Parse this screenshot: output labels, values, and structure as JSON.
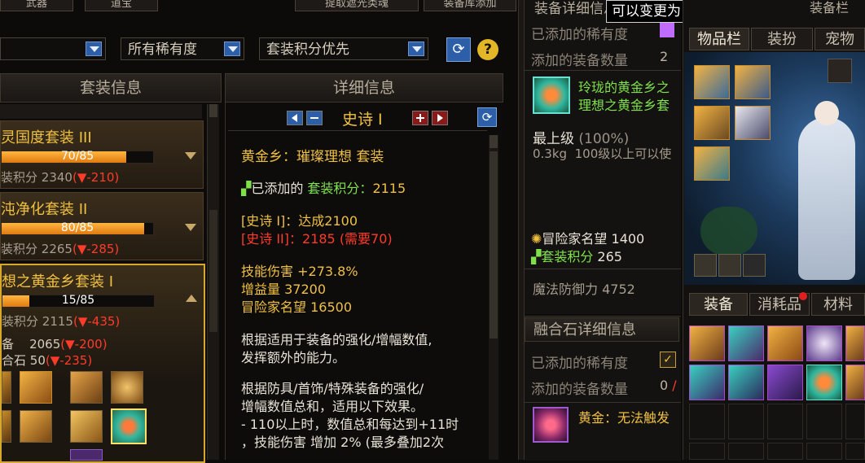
{
  "top_tabs": [
    "武器",
    "道宝",
    "提取遮光类魂",
    "装备库添加"
  ],
  "filters": {
    "rarity": "所有稀有度",
    "sort": "套装积分优先"
  },
  "left_header": "套装信息",
  "left_sets": [
    {
      "name": "灵国度套装 III",
      "progress": "70/85",
      "fill": 0.82,
      "points_label": "装积分",
      "points": "2340",
      "delta": "(▼-210)"
    },
    {
      "name": "沌净化套装 II",
      "progress": "80/85",
      "fill": 0.94,
      "points_label": "装积分",
      "points": "2265",
      "delta": "(▼-285)"
    },
    {
      "name": "想之黄金乡套装 I",
      "progress": "15/85",
      "fill": 0.18,
      "points_label": "装积分",
      "points": "2115",
      "delta": "(▼-435)"
    }
  ],
  "left_extra": [
    {
      "label": "备",
      "value": "2065",
      "delta": "(▼-200)"
    },
    {
      "label": "合石",
      "value": "50",
      "delta": "(▼-235)"
    }
  ],
  "detail": {
    "header": "详细信息",
    "grade": "史诗 I",
    "title": "黄金乡：璀璨理想  套装",
    "added_label": "已添加的",
    "set_points_label": "套装积分：",
    "set_points": "2115",
    "req1": "[史诗 I]：达成2100",
    "req2": "[史诗 II]：2185 (需要70)",
    "stat1_label": "技能伤害",
    "stat1_value": "+273.8%",
    "stat2_label": "增益量",
    "stat2_value": "37200",
    "stat3_label": "冒险家名望",
    "stat3_value": "16500",
    "para1_l1": "根据适用于装备的强化/增幅数值,",
    "para1_l2": "发挥额外的能力。",
    "para2_l1": "根据防具/首饰/特殊装备的强化/",
    "para2_l2": "增幅数值总和，适用以下效果。",
    "para2_l3": "- 110以上时，数值总和每达到+11时",
    "para2_l4": "，技能伤害 增加 2% (最多叠加2次"
  },
  "equip_detail": {
    "header": "装备详细信息",
    "tooltip": "可以变更为",
    "rarity_label": "已添加的稀有度",
    "count_label": "添加的装备数量",
    "count": "2",
    "item_name_l1": "玲珑的黄金乡之",
    "item_name_l2": "理想之黄金乡套",
    "grade": "最上级",
    "grade_pct": "(100%)",
    "weight": "0.3kg",
    "level_req": "100级以上可以使",
    "fame_label": "冒险家名望",
    "fame": "1400",
    "setpt_label": "套装积分",
    "setpt": "265",
    "magic_def_label": "魔法防御力",
    "magic_def": "4752"
  },
  "fusion": {
    "header": "融合石详细信息",
    "rarity_label": "已添加的稀有度",
    "count_label": "添加的装备数量",
    "count": "0",
    "item_name": "黄金：无法触发"
  },
  "inventory": {
    "header": "装备栏",
    "tabs": [
      "物品栏",
      "装扮",
      "宠物"
    ],
    "bottom_tabs": [
      "装备",
      "消耗品",
      "材料"
    ]
  },
  "colors": {
    "gold": "#f0c040",
    "green": "#7ee04a",
    "red": "#ff3b2a",
    "epic_purple": "#c06cff"
  }
}
